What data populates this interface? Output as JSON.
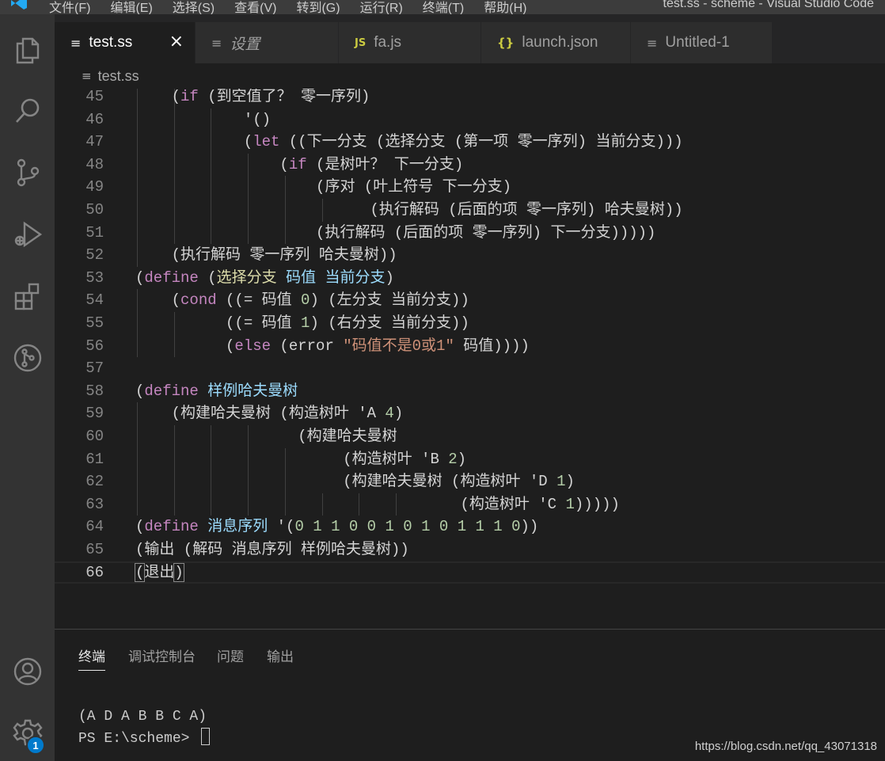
{
  "menu": [
    "文件(F)",
    "编辑(E)",
    "选择(S)",
    "查看(V)",
    "转到(G)",
    "运行(R)",
    "终端(T)",
    "帮助(H)"
  ],
  "window_title": "test.ss - scheme - Visual Studio Code",
  "tabs": [
    {
      "label": "test.ss",
      "icon": "lines-icon",
      "active": true,
      "close": "×"
    },
    {
      "label": "设置",
      "icon": "lines-icon"
    },
    {
      "label": "fa.js",
      "icon": "js-icon",
      "icon_text": "JS"
    },
    {
      "label": "launch.json",
      "icon": "json-icon",
      "icon_text": "{}"
    },
    {
      "label": "Untitled-1",
      "icon": "lines-icon"
    }
  ],
  "breadcrumb": "test.ss",
  "editor": {
    "current_line": 66,
    "lines": [
      {
        "n": "45",
        "guides": 2,
        "tokens": [
          [
            "    ",
            "p"
          ],
          [
            "(",
            "p"
          ],
          [
            "if",
            "k"
          ],
          [
            " (到空值了？ 零一序列)",
            "p"
          ]
        ]
      },
      {
        "n": "46",
        "guides": 3,
        "tokens": [
          [
            "            '()",
            "p"
          ]
        ]
      },
      {
        "n": "47",
        "guides": 3,
        "tokens": [
          [
            "            (",
            "p"
          ],
          [
            "let",
            "k"
          ],
          [
            " ((下一分支 (选择分支 (第一项 零一序列) 当前分支)))",
            "p"
          ]
        ]
      },
      {
        "n": "48",
        "guides": 4,
        "tokens": [
          [
            "                (",
            "p"
          ],
          [
            "if",
            "k"
          ],
          [
            " (是树叶？ 下一分支)",
            "p"
          ]
        ]
      },
      {
        "n": "49",
        "guides": 5,
        "tokens": [
          [
            "                    (序对 (叶上符号 下一分支)",
            "p"
          ]
        ]
      },
      {
        "n": "50",
        "guides": 6,
        "tokens": [
          [
            "                          (执行解码 (后面的项 零一序列) 哈夫曼树))",
            "p"
          ]
        ]
      },
      {
        "n": "51",
        "guides": 5,
        "tokens": [
          [
            "                    (执行解码 (后面的项 零一序列) 下一分支)))))",
            "p"
          ]
        ]
      },
      {
        "n": "52",
        "guides": 1,
        "tokens": [
          [
            "    (执行解码 零一序列 哈夫曼树))",
            "p"
          ]
        ]
      },
      {
        "n": "53",
        "guides": 0,
        "tokens": [
          [
            "(",
            "p"
          ],
          [
            "define",
            "k"
          ],
          [
            " (",
            "p"
          ],
          [
            "选择分支",
            "d"
          ],
          [
            " ",
            "p"
          ],
          [
            "码值",
            "v"
          ],
          [
            " ",
            "p"
          ],
          [
            "当前分支",
            "v"
          ],
          [
            ")",
            "p"
          ]
        ]
      },
      {
        "n": "54",
        "guides": 1,
        "tokens": [
          [
            "    (",
            "p"
          ],
          [
            "cond",
            "k"
          ],
          [
            " ((= 码值 ",
            "p"
          ],
          [
            "0",
            "n"
          ],
          [
            ") (左分支 当前分支))",
            "p"
          ]
        ]
      },
      {
        "n": "55",
        "guides": 2,
        "tokens": [
          [
            "          ((= 码值 ",
            "p"
          ],
          [
            "1",
            "n"
          ],
          [
            ") (右分支 当前分支))",
            "p"
          ]
        ]
      },
      {
        "n": "56",
        "guides": 2,
        "tokens": [
          [
            "          (",
            "p"
          ],
          [
            "else",
            "k"
          ],
          [
            " (error ",
            "p"
          ],
          [
            "\"码值不是0或1\"",
            "s"
          ],
          [
            " 码值))))",
            "p"
          ]
        ]
      },
      {
        "n": "57",
        "guides": 0,
        "tokens": []
      },
      {
        "n": "58",
        "guides": 0,
        "tokens": [
          [
            "(",
            "p"
          ],
          [
            "define",
            "k"
          ],
          [
            " ",
            "p"
          ],
          [
            "样例哈夫曼树",
            "v"
          ]
        ]
      },
      {
        "n": "59",
        "guides": 1,
        "tokens": [
          [
            "    (构建哈夫曼树 (构造树叶 'A ",
            "p"
          ],
          [
            "4",
            "n"
          ],
          [
            ")",
            "p"
          ]
        ]
      },
      {
        "n": "60",
        "guides": 4,
        "tokens": [
          [
            "                  (构建哈夫曼树",
            "p"
          ]
        ]
      },
      {
        "n": "61",
        "guides": 5,
        "tokens": [
          [
            "                       (构造树叶 'B ",
            "p"
          ],
          [
            "2",
            "n"
          ],
          [
            ")",
            "p"
          ]
        ]
      },
      {
        "n": "62",
        "guides": 5,
        "tokens": [
          [
            "                       (构建哈夫曼树 (构造树叶 'D ",
            "p"
          ],
          [
            "1",
            "n"
          ],
          [
            ")",
            "p"
          ]
        ]
      },
      {
        "n": "63",
        "guides": 8,
        "tokens": [
          [
            "                                    (构造树叶 'C ",
            "p"
          ],
          [
            "1",
            "n"
          ],
          [
            ")))))",
            "p"
          ]
        ]
      },
      {
        "n": "64",
        "guides": 0,
        "tokens": [
          [
            "(",
            "p"
          ],
          [
            "define",
            "k"
          ],
          [
            " ",
            "p"
          ],
          [
            "消息序列",
            "v"
          ],
          [
            " '(",
            "p"
          ],
          [
            "0 1 1 0 0 1 0 1 0 1 1 1 0",
            "n"
          ],
          [
            "))",
            "p"
          ]
        ]
      },
      {
        "n": "65",
        "guides": 0,
        "tokens": [
          [
            "(输出 (解码 消息序列 样例哈夫曼树))",
            "p"
          ]
        ]
      },
      {
        "n": "66",
        "guides": 0,
        "tokens": [
          [
            "(",
            "b"
          ],
          [
            "退出",
            "p"
          ],
          [
            ")",
            "b"
          ]
        ]
      }
    ]
  },
  "panel": {
    "tabs": [
      "终端",
      "调试控制台",
      "问题",
      "输出"
    ],
    "active_tab": "终端",
    "terminal": [
      "(A D A B B C A)",
      "PS E:\\scheme> "
    ]
  },
  "activity_icons": [
    "files-icon",
    "search-icon",
    "source-control-icon",
    "run-debug-icon",
    "extensions-icon",
    "git-graph-icon",
    "account-icon",
    "settings-gear-icon"
  ],
  "settings_badge": "1",
  "watermark": "https://blog.csdn.net/qq_43071318"
}
